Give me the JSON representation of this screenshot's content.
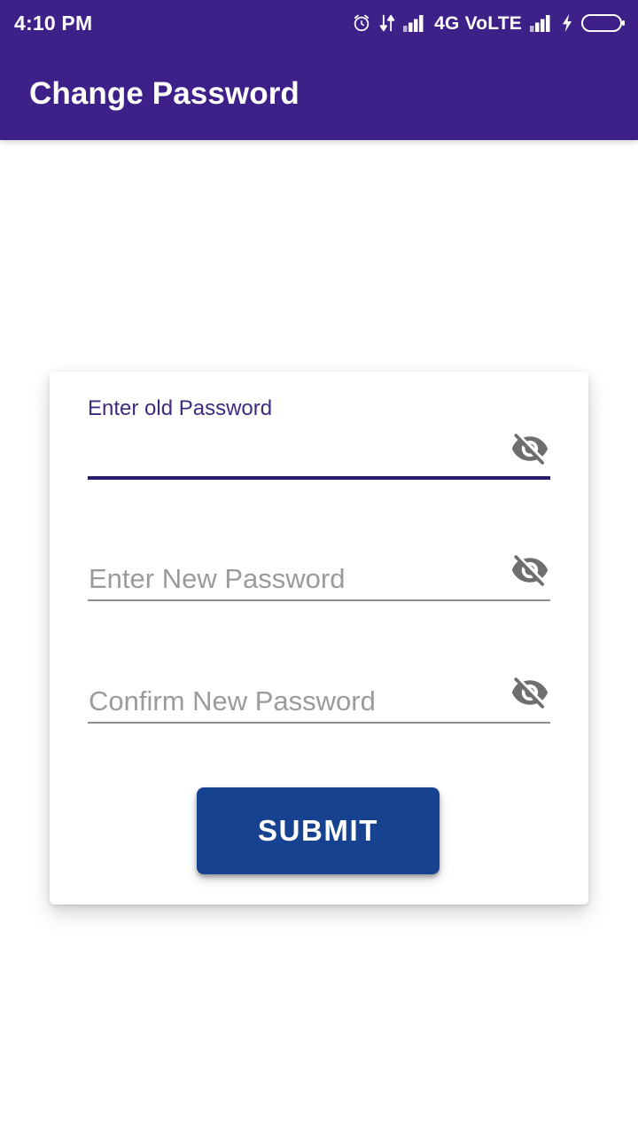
{
  "status_bar": {
    "time": "4:10 PM",
    "network_label": "4G VoLTE",
    "icons": [
      "alarm-clock-icon",
      "data-transfer-icon",
      "signal-bars-sim1-icon",
      "signal-bars-sim2-icon",
      "charging-bolt-icon",
      "battery-icon"
    ],
    "background_color": "#3D2189"
  },
  "app_bar": {
    "title": "Change Password",
    "background_color": "#3D2189",
    "title_color": "#FFFFFF"
  },
  "card": {
    "fields": [
      {
        "name": "old-password",
        "label": "Enter old Password",
        "value": "",
        "placeholder": "",
        "focused": true,
        "underline_color": "#2B1A6E",
        "label_color": "#3F2A80",
        "toggle_icon": "eye-off-icon"
      },
      {
        "name": "new-password",
        "label": "",
        "value": "",
        "placeholder": "Enter New Password",
        "focused": false,
        "underline_color": "#8D8D8D",
        "label_color": "#9B9B9B",
        "toggle_icon": "eye-off-icon"
      },
      {
        "name": "confirm-password",
        "label": "",
        "value": "",
        "placeholder": "Confirm New Password",
        "focused": false,
        "underline_color": "#8D8D8D",
        "label_color": "#9B9B9B",
        "toggle_icon": "eye-off-icon"
      }
    ],
    "submit_label": "SUBMIT",
    "submit_color": "#17428F"
  }
}
